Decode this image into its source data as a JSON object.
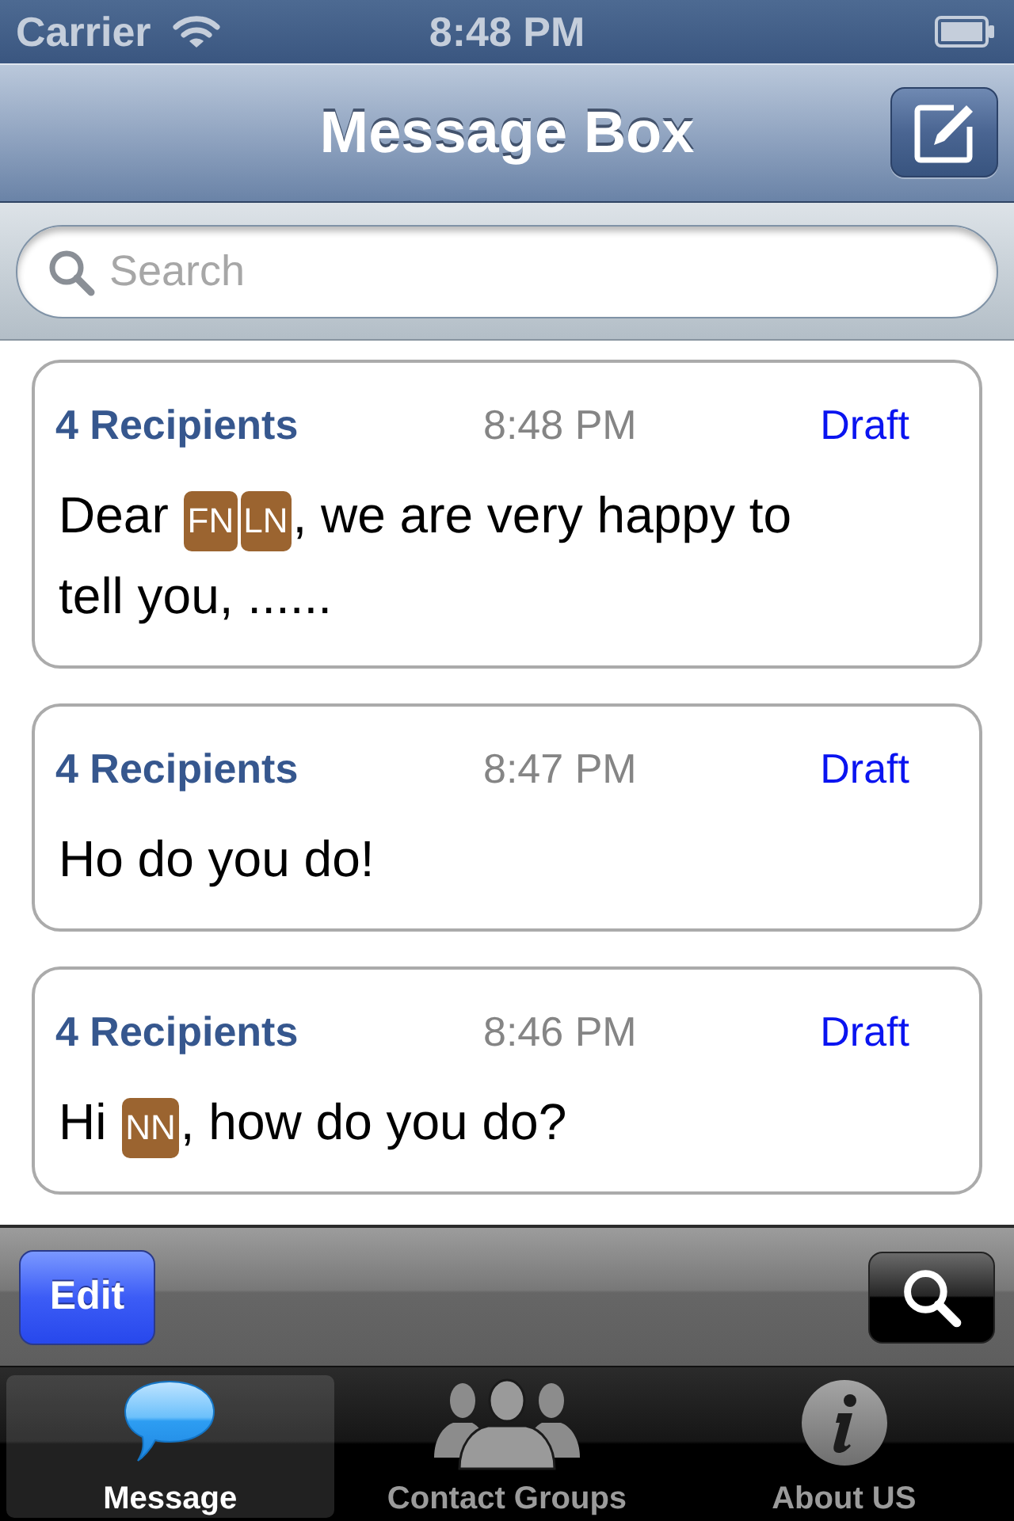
{
  "status_bar": {
    "carrier": "Carrier",
    "time": "8:48 PM"
  },
  "nav_bar": {
    "title": "Message Box"
  },
  "search": {
    "placeholder": "Search"
  },
  "messages": [
    {
      "recipients": "4 Recipients",
      "time": "8:48 PM",
      "status": "Draft",
      "body_lines": [
        [
          {
            "kind": "text",
            "text": "Dear "
          },
          {
            "kind": "token",
            "text": "FN"
          },
          {
            "kind": "token",
            "text": "LN"
          },
          {
            "kind": "text",
            "text": ", we are very happy to"
          }
        ],
        [
          {
            "kind": "text",
            "text": "tell you, ......"
          }
        ]
      ]
    },
    {
      "recipients": "4 Recipients",
      "time": "8:47 PM",
      "status": "Draft",
      "body_lines": [
        [
          {
            "kind": "text",
            "text": "Ho do you do!"
          }
        ]
      ]
    },
    {
      "recipients": "4 Recipients",
      "time": "8:46 PM",
      "status": "Draft",
      "body_lines": [
        [
          {
            "kind": "text",
            "text": "Hi "
          },
          {
            "kind": "token",
            "text": "NN"
          },
          {
            "kind": "text",
            "text": ", how do you do?"
          }
        ]
      ]
    }
  ],
  "toolbar": {
    "edit_button": "Edit"
  },
  "tab_bar": [
    {
      "label": "Message",
      "selected": true
    },
    {
      "label": "Contact Groups",
      "selected": false
    },
    {
      "label": "About US",
      "selected": false
    }
  ]
}
